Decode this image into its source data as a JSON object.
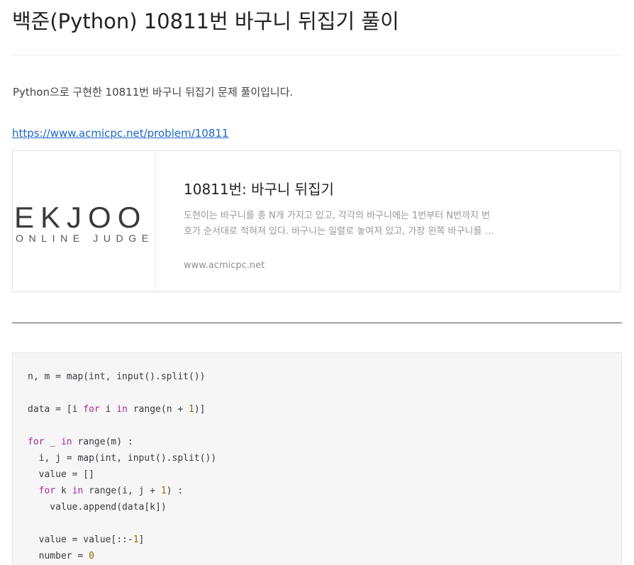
{
  "post": {
    "title": "백준(Python) 10811번 바구니 뒤집기 풀이",
    "intro": "Python으로 구현한 10811번 바구니 뒤집기 문제 풀이입니다.",
    "link_text": "https://www.acmicpc.net/problem/10811"
  },
  "og_card": {
    "logo_text_main": "EKJOO",
    "logo_text_sub": "ONLINE JUDGE",
    "title": "10811번: 바구니 뒤집기",
    "description_line1": "도현이는 바구니를 총 N개 가지고 있고, 각각의 바구니에는 1번부터 N번까지 번",
    "description_line2": "호가 순서대로 적혀져 있다. 바구니는 일렬로 놓여져 있고, 가장 왼쪽 바구니를 …",
    "host": "www.acmicpc.net"
  },
  "code": {
    "language": "python",
    "lines": [
      "n, m = map(int, input().split())",
      "",
      "data = [i for i in range(n + 1)]",
      "",
      "for _ in range(m) :",
      "  i, j = map(int, input().split())",
      "  value = []",
      "  for k in range(i, j + 1) :",
      "    value.append(data[k])",
      "",
      "  value = value[::-1]",
      "  number = 0"
    ]
  },
  "colors": {
    "link": "#1e66c9",
    "keyword": "#a626a4",
    "number": "#986801",
    "code_background": "#f6f6f6"
  }
}
